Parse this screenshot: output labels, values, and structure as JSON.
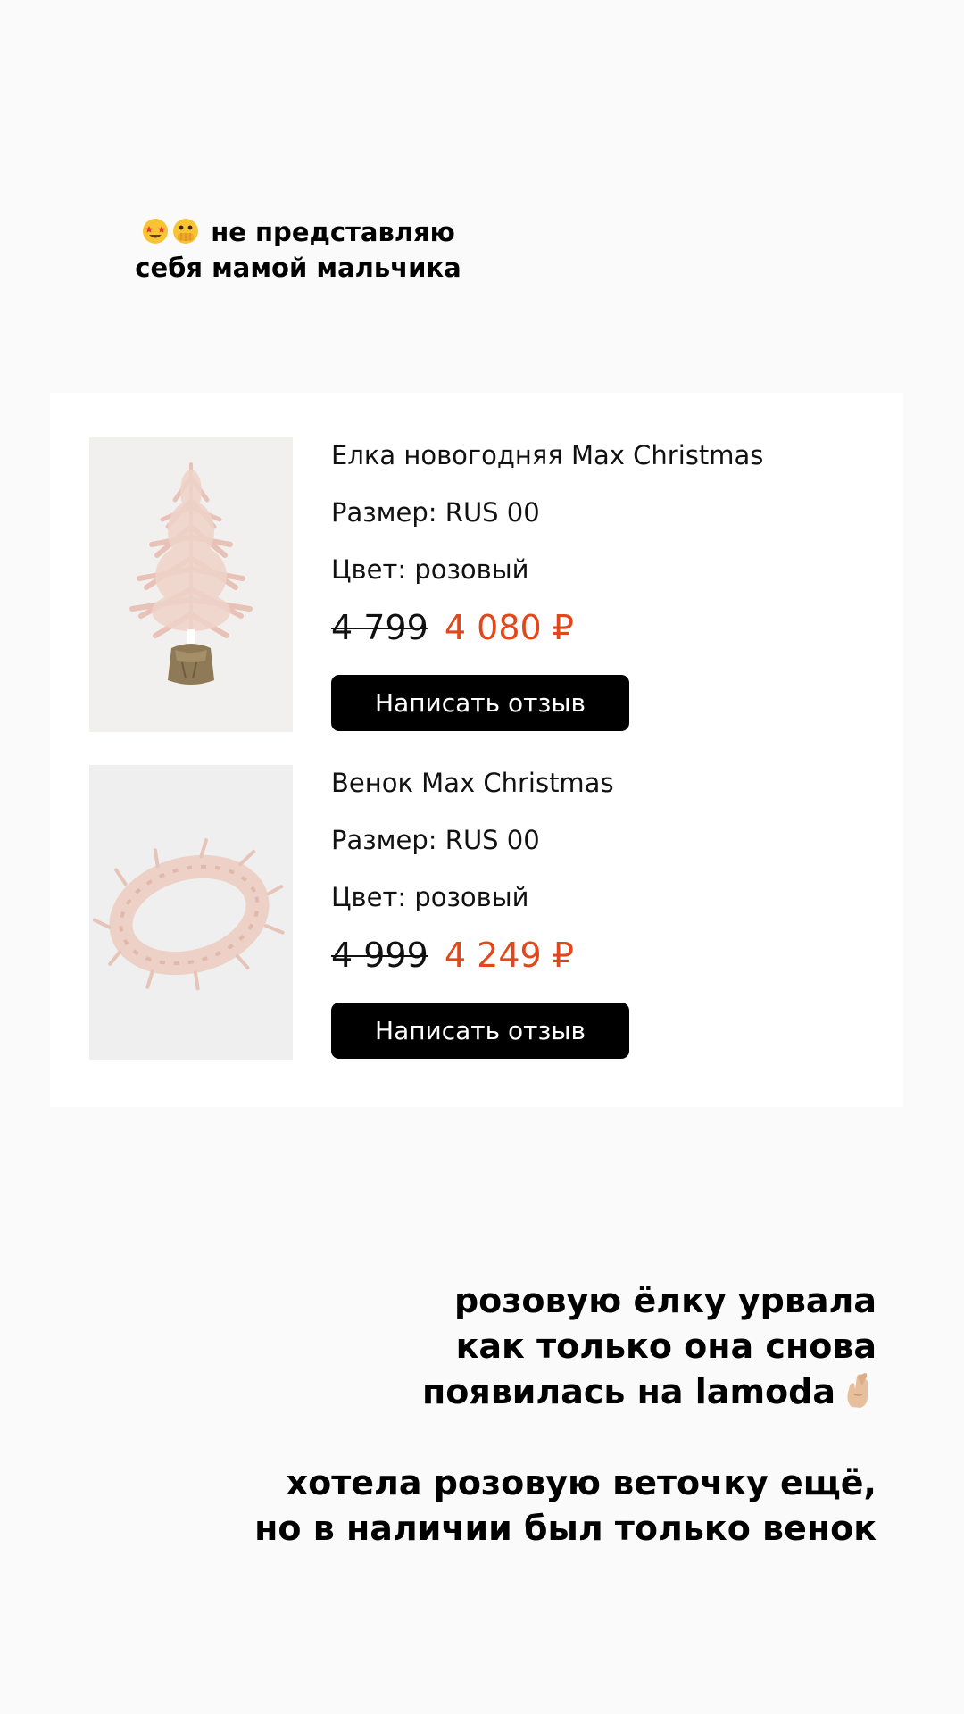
{
  "caption_top": {
    "emojis": [
      "star-struck-emoji",
      "face-with-open-eyes-and-hand-over-mouth-emoji"
    ],
    "line1": "не представляю",
    "line2": "себя мамой мальчика"
  },
  "order": {
    "products": [
      {
        "name": "Елка новогодняя Max Christmas",
        "size": "Размер: RUS 00",
        "color": "Цвет: розовый",
        "old_price": "4 799",
        "new_price": "4 080 ₽",
        "button_label": "Написать отзыв",
        "image_icon": "pink-christmas-tree-in-burlap-pot"
      },
      {
        "name": "Венок Max Christmas",
        "size": "Размер: RUS 00",
        "color": "Цвет: розовый",
        "old_price": "4 999",
        "new_price": "4 249 ₽",
        "button_label": "Написать отзыв",
        "image_icon": "pink-feather-wreath"
      }
    ]
  },
  "caption_bottom": {
    "line1": "розовую ёлку урвала",
    "line2": "как только она снова",
    "line3": "появилась на lamoda",
    "line3_emoji": "crossed-fingers-emoji",
    "line4": "хотела розовую веточку ещё,",
    "line5": "но в наличии был только венок"
  },
  "colors": {
    "background": "#fafafa",
    "card": "#ffffff",
    "sale_price": "#e0481c",
    "button": "#000000"
  }
}
